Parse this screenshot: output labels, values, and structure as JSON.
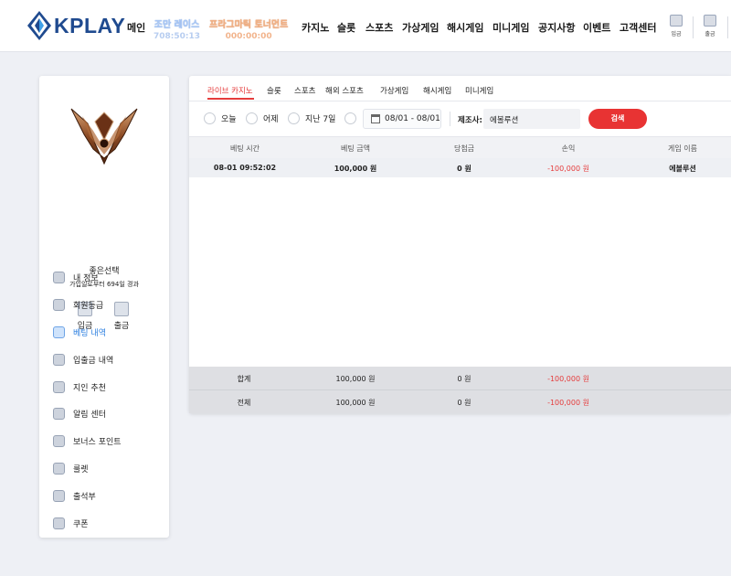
{
  "header": {
    "logo_text": "KPLAY",
    "nav": [
      "메인",
      "카지노",
      "슬롯",
      "스포츠",
      "가상게임",
      "해시게임",
      "미니게임",
      "공지사항",
      "이벤트",
      "고객센터"
    ],
    "promo_1": {
      "title": "조만 레이스",
      "time": "708:50:13"
    },
    "promo_2": {
      "title": "프라그마틱 토너먼트",
      "time": "000:00:00"
    },
    "deposit_label": "입금",
    "withdraw_label": "출금"
  },
  "sidebar": {
    "user_name": "좋은선택",
    "join_days": "가입일로부터 694일 경과",
    "deposit_label": "입금",
    "withdraw_label": "출금",
    "menu": [
      {
        "label": "내 정보",
        "icon": "user-icon"
      },
      {
        "label": "회원등급",
        "icon": "grade-icon"
      },
      {
        "label": "베팅 내역",
        "icon": "betting-history-icon",
        "active": true
      },
      {
        "label": "입출금 내역",
        "icon": "transaction-icon"
      },
      {
        "label": "지인 추천",
        "icon": "referral-icon"
      },
      {
        "label": "알림 센터",
        "icon": "notification-icon"
      },
      {
        "label": "보너스 포인트",
        "icon": "bonus-point-icon"
      },
      {
        "label": "룰렛",
        "icon": "roulette-icon"
      },
      {
        "label": "출석부",
        "icon": "attendance-icon"
      },
      {
        "label": "쿠폰",
        "icon": "coupon-icon"
      }
    ],
    "active_color": "#2c7fe0"
  },
  "tabs": [
    "라이브 카지노",
    "슬롯",
    "스포츠",
    "해외 스포츠",
    "가상게임",
    "해시게임",
    "미니게임"
  ],
  "filters": {
    "today": "오늘",
    "yesterday": "어제",
    "last7": "지난 7일",
    "date_range": "08/01 - 08/01",
    "provider_label": "제조사:",
    "provider_value": "에볼루션",
    "search_label": "검색"
  },
  "table": {
    "headers": [
      "베팅 시간",
      "베팅 금액",
      "당첨금",
      "손익",
      "게임 이름"
    ],
    "rows": [
      {
        "time": "08-01 09:52:02",
        "bet": "100,000 원",
        "win": "0 원",
        "profit": "-100,000 원",
        "game": "에볼루션"
      }
    ],
    "sum_label": "합계",
    "sum_bet": "100,000 원",
    "sum_win": "0 원",
    "sum_profit": "-100,000 원",
    "total_label": "전체",
    "total_bet": "100,000 원",
    "total_win": "0 원",
    "total_profit": "-100,000 원"
  },
  "colors": {
    "accent_red": "#e83333",
    "brand_blue": "#1f4a8f"
  }
}
